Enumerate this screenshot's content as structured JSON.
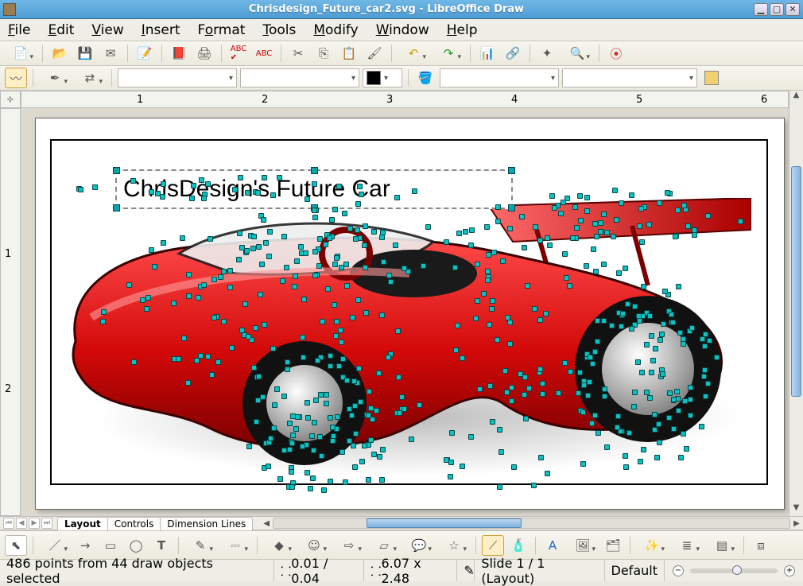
{
  "title": "Chrisdesign_Future_car2.svg - LibreOffice Draw",
  "menus": [
    "File",
    "Edit",
    "View",
    "Insert",
    "Format",
    "Tools",
    "Modify",
    "Window",
    "Help"
  ],
  "menu_accel": [
    "F",
    "E",
    "V",
    "I",
    "o",
    "T",
    "M",
    "W",
    "H"
  ],
  "tabs": {
    "layout": "Layout",
    "controls": "Controls",
    "dimension": "Dimension Lines"
  },
  "canvas_text": "ChrisDesign's Future Car",
  "ruler_h": [
    "1",
    "2",
    "3",
    "4",
    "5",
    "6"
  ],
  "ruler_v": [
    "1",
    "2"
  ],
  "status": {
    "selection": "486 points from 44 draw objects selected",
    "pos": "0.01 / 0.04",
    "size": "6.07 x 2.48",
    "slide": "Slide 1 / 1 (Layout)",
    "style": "Default"
  }
}
